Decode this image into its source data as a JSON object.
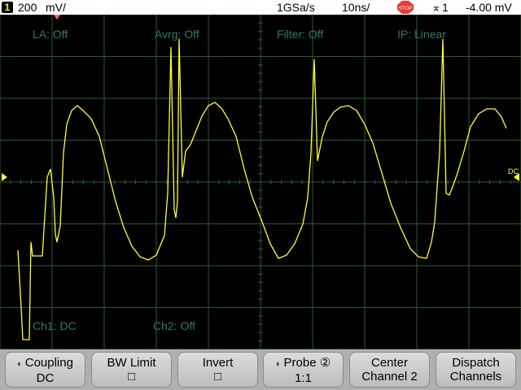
{
  "status": {
    "channel_number": "1",
    "vertical_scale": "200",
    "vertical_unit": "mV/",
    "sample_rate": "1GSa/s",
    "timebase": "10ns/",
    "run_state": "STOP",
    "trigger_channel": "1",
    "trigger_level": "-4.00 mV"
  },
  "overlay": {
    "la": "LA: Off",
    "avrg": "Avrg: Off",
    "filter": "Filter: Off",
    "ip": "IP: Linear",
    "ch1": "Ch1: DC",
    "ch2": "Ch2: Off",
    "dc_marker": "DC"
  },
  "softkeys": [
    {
      "label": "Coupling",
      "value": "DC",
      "arrow": true
    },
    {
      "label": "BW Limit",
      "value": "□",
      "arrow": false
    },
    {
      "label": "Invert",
      "value": "□",
      "arrow": false
    },
    {
      "label": "Probe ②",
      "value": "1:1",
      "arrow": true
    },
    {
      "label": "Center",
      "value": "Channel 2",
      "arrow": false
    },
    {
      "label": "Dispatch",
      "value": "Channels",
      "arrow": false
    }
  ],
  "colors": {
    "trace": "#ffff33",
    "grid": "#2a5a3a",
    "overlay_text": "#2e7d5b"
  }
}
